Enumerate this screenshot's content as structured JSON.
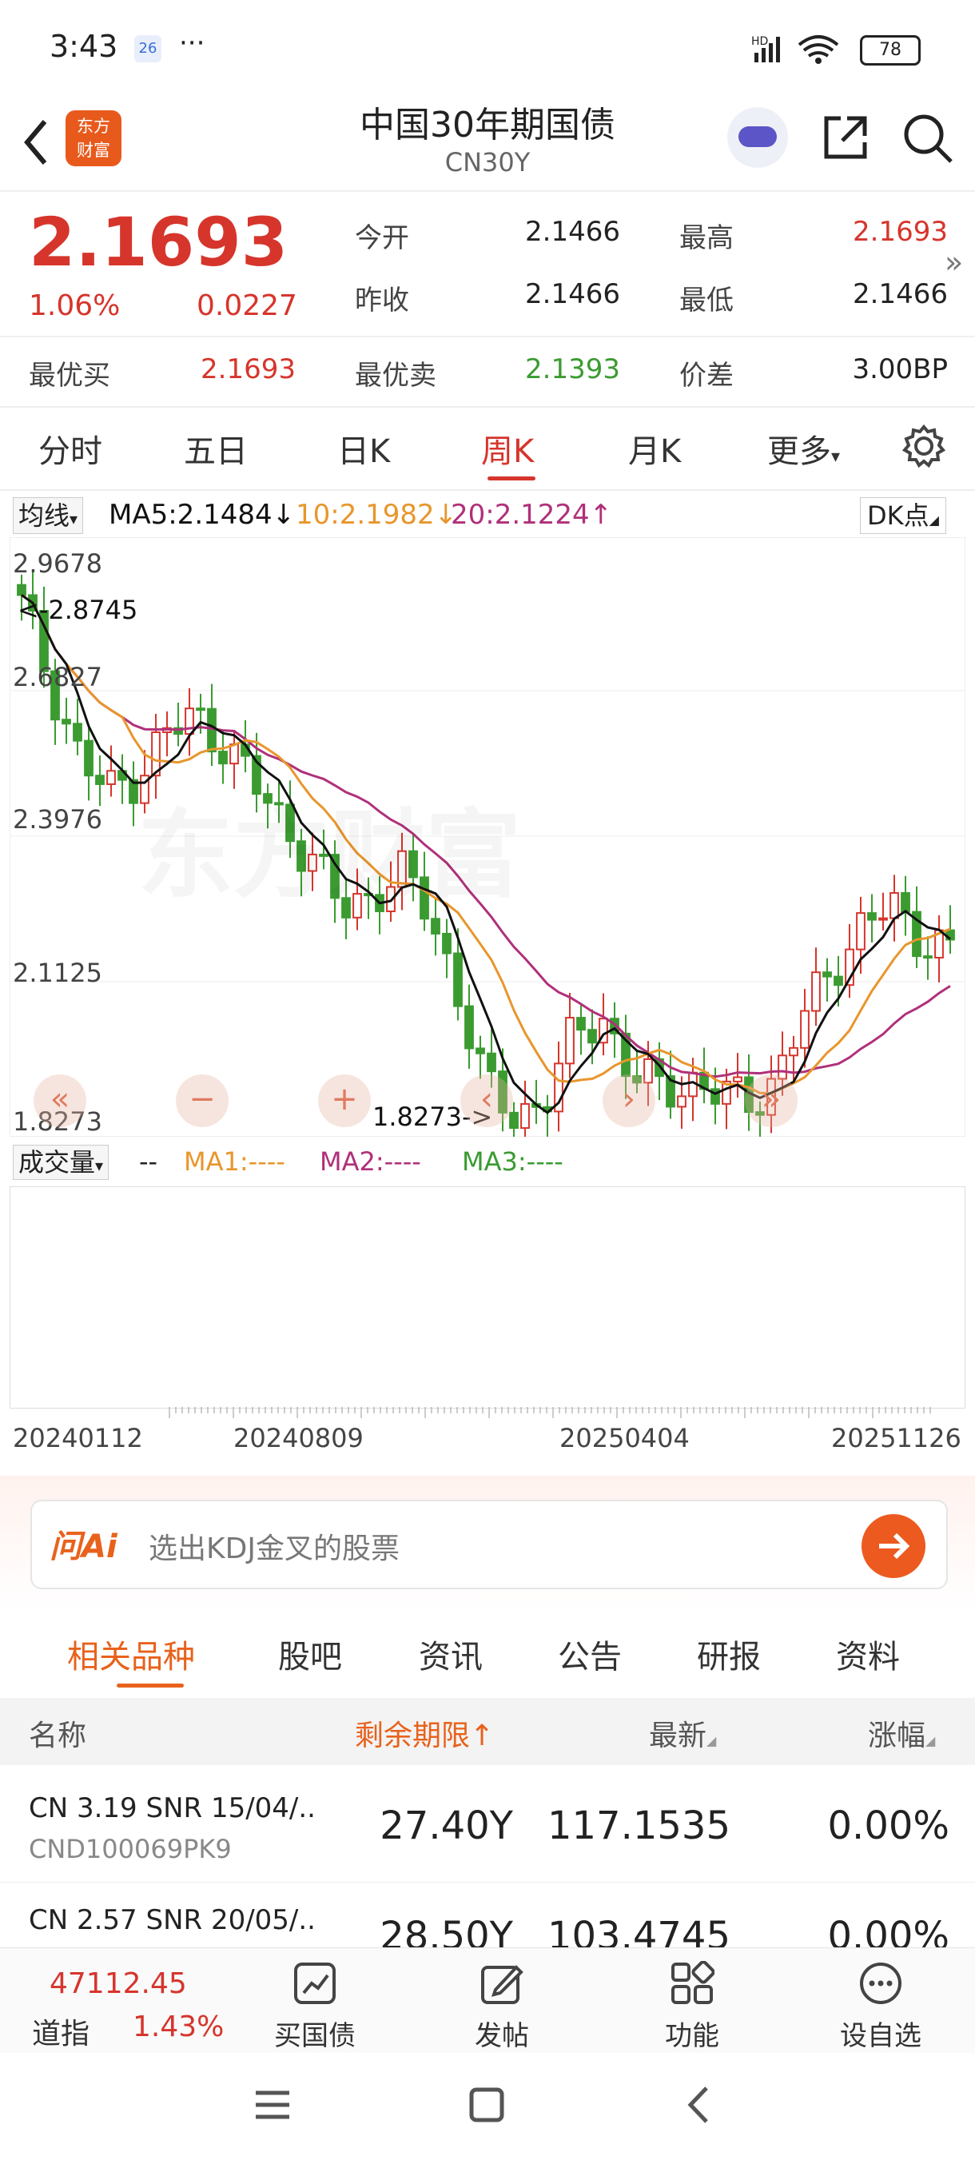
{
  "status_bar": {
    "time": "3:43",
    "notif_badge": "26",
    "more": "···",
    "battery": "78"
  },
  "header": {
    "title": "中国30年期国债",
    "code": "CN30Y",
    "logo_line1": "东方",
    "logo_line2": "财富"
  },
  "quote": {
    "price": "2.1693",
    "change_pct": "1.06%",
    "change": "0.0227",
    "open_label": "今开",
    "open": "2.1466",
    "high_label": "最高",
    "high": "2.1693",
    "prev_close_label": "昨收",
    "prev_close": "2.1466",
    "low_label": "最低",
    "low": "2.1466",
    "best_bid_label": "最优买",
    "best_bid": "2.1693",
    "best_ask_label": "最优卖",
    "best_ask": "2.1393",
    "spread_label": "价差",
    "spread": "3.00BP",
    "expand": "»"
  },
  "chart_tabs": [
    "分时",
    "五日",
    "日K",
    "周K",
    "月K",
    "更多"
  ],
  "chart_tab_active": 3,
  "ma_bar": {
    "selector": "均线",
    "ma5": "MA5:2.1484↓",
    "ma10": "10:2.1982↓",
    "ma20": "20:2.1224↑",
    "dk": "DK点"
  },
  "price_axis": [
    "2.9678",
    "2.6827",
    "2.3976",
    "2.1125",
    "1.8273"
  ],
  "annotations": {
    "high": "<-2.8745",
    "low": "1.8273->"
  },
  "volume_bar": {
    "selector": "成交量",
    "dash": "--",
    "ma1": "MA1:----",
    "ma2": "MA2:----",
    "ma3": "MA3:----"
  },
  "date_axis": [
    "20240112",
    "20240809",
    "20250404",
    "20251126"
  ],
  "ai": {
    "brand": "问Ai",
    "placeholder": "选出KDJ金叉的股票"
  },
  "news_tabs": [
    "相关品种",
    "股吧",
    "资讯",
    "公告",
    "研报",
    "资料"
  ],
  "news_tab_active": 0,
  "table": {
    "headers": {
      "name": "名称",
      "term": "剩余期限↑",
      "latest": "最新",
      "change": "涨幅"
    },
    "rows": [
      {
        "name": "CN 3.19 SNR 15/04/..",
        "code": "CND100069PK9",
        "term": "27.40Y",
        "latest": "117.1535",
        "change": "0.00%"
      },
      {
        "name": "CN 2.57 SNR 20/05/..",
        "code": "",
        "term": "28.50Y",
        "latest": "103.4745",
        "change": "0.00%"
      }
    ]
  },
  "bottom_nav": {
    "index_value": "47112.45",
    "index_name": "道指",
    "index_change": "1.43%",
    "items": [
      "买国债",
      "发帖",
      "功能",
      "设自选"
    ]
  },
  "chart_data": {
    "type": "candlestick",
    "title": "",
    "y_range": [
      1.8273,
      2.9678
    ],
    "x_ticks": [
      "20240112",
      "20240809",
      "20250404",
      "20251126"
    ],
    "close_points": [
      2.85,
      2.7,
      2.55,
      2.48,
      2.52,
      2.6,
      2.63,
      2.58,
      2.5,
      2.42,
      2.36,
      2.25,
      2.28,
      2.33,
      2.25,
      2.1,
      1.9,
      1.85,
      1.88,
      2.0,
      2.05,
      1.93,
      1.9,
      1.92,
      1.89,
      1.88,
      1.92,
      2.05,
      2.15,
      2.22,
      2.26,
      2.2,
      2.17
    ],
    "ma5": 2.1484,
    "ma10": 2.1982,
    "ma20": 2.1224,
    "max_marker": 2.8745,
    "min_marker": 1.8273,
    "colors": {
      "up": "#d6352c",
      "down": "#3b9b31",
      "ma5": "#111111",
      "ma10": "#e8962c",
      "ma20": "#b0307a"
    }
  }
}
